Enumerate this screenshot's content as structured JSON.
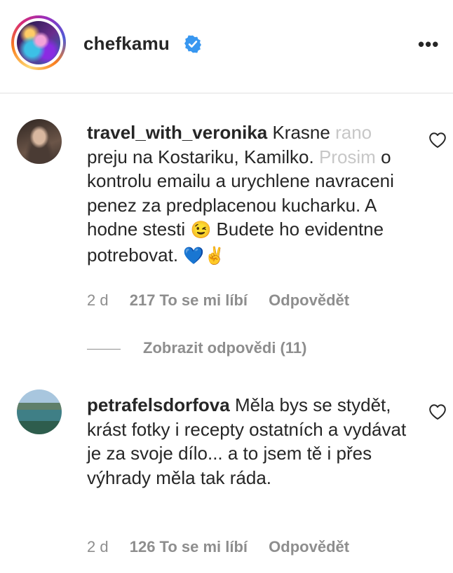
{
  "post": {
    "username": "chefkamu",
    "more_label": "•••"
  },
  "comments": [
    {
      "username": "travel_with_veronika",
      "text_a": "Krasne ",
      "text_faded1": "rano",
      "text_b": " preju na Kostariku, Kamilko. ",
      "text_faded2": "Prosim",
      "text_c": " o kontrolu emailu a urychlene navraceni penez za predplacenou kucharku. A hodne stesti ",
      "emoji1": "😉",
      "text_d": " Budete ho evidentne potrebovat. ",
      "emoji2": "💙✌️",
      "time": "2 d",
      "likes": "217 To se mi líbí",
      "reply": "Odpovědět"
    },
    {
      "username": "petrafelsdorfova",
      "text": " Měla bys se stydět, krást fotky i recepty ostatních a vydávat je za svoje dílo... a to jsem tě i přes výhrady měla tak ráda.",
      "time": "2 d",
      "likes": "126 To se mi líbí",
      "reply": "Odpovědět"
    }
  ],
  "view_replies": "Zobrazit odpovědi (11)",
  "colors": {
    "text": "#262626",
    "secondary": "#8e8e8e",
    "verified": "#3897f0",
    "divider": "#efefef"
  },
  "icons": {
    "verified": "verified-badge-icon",
    "heart": "heart-outline-icon",
    "more": "more-horizontal-icon"
  }
}
